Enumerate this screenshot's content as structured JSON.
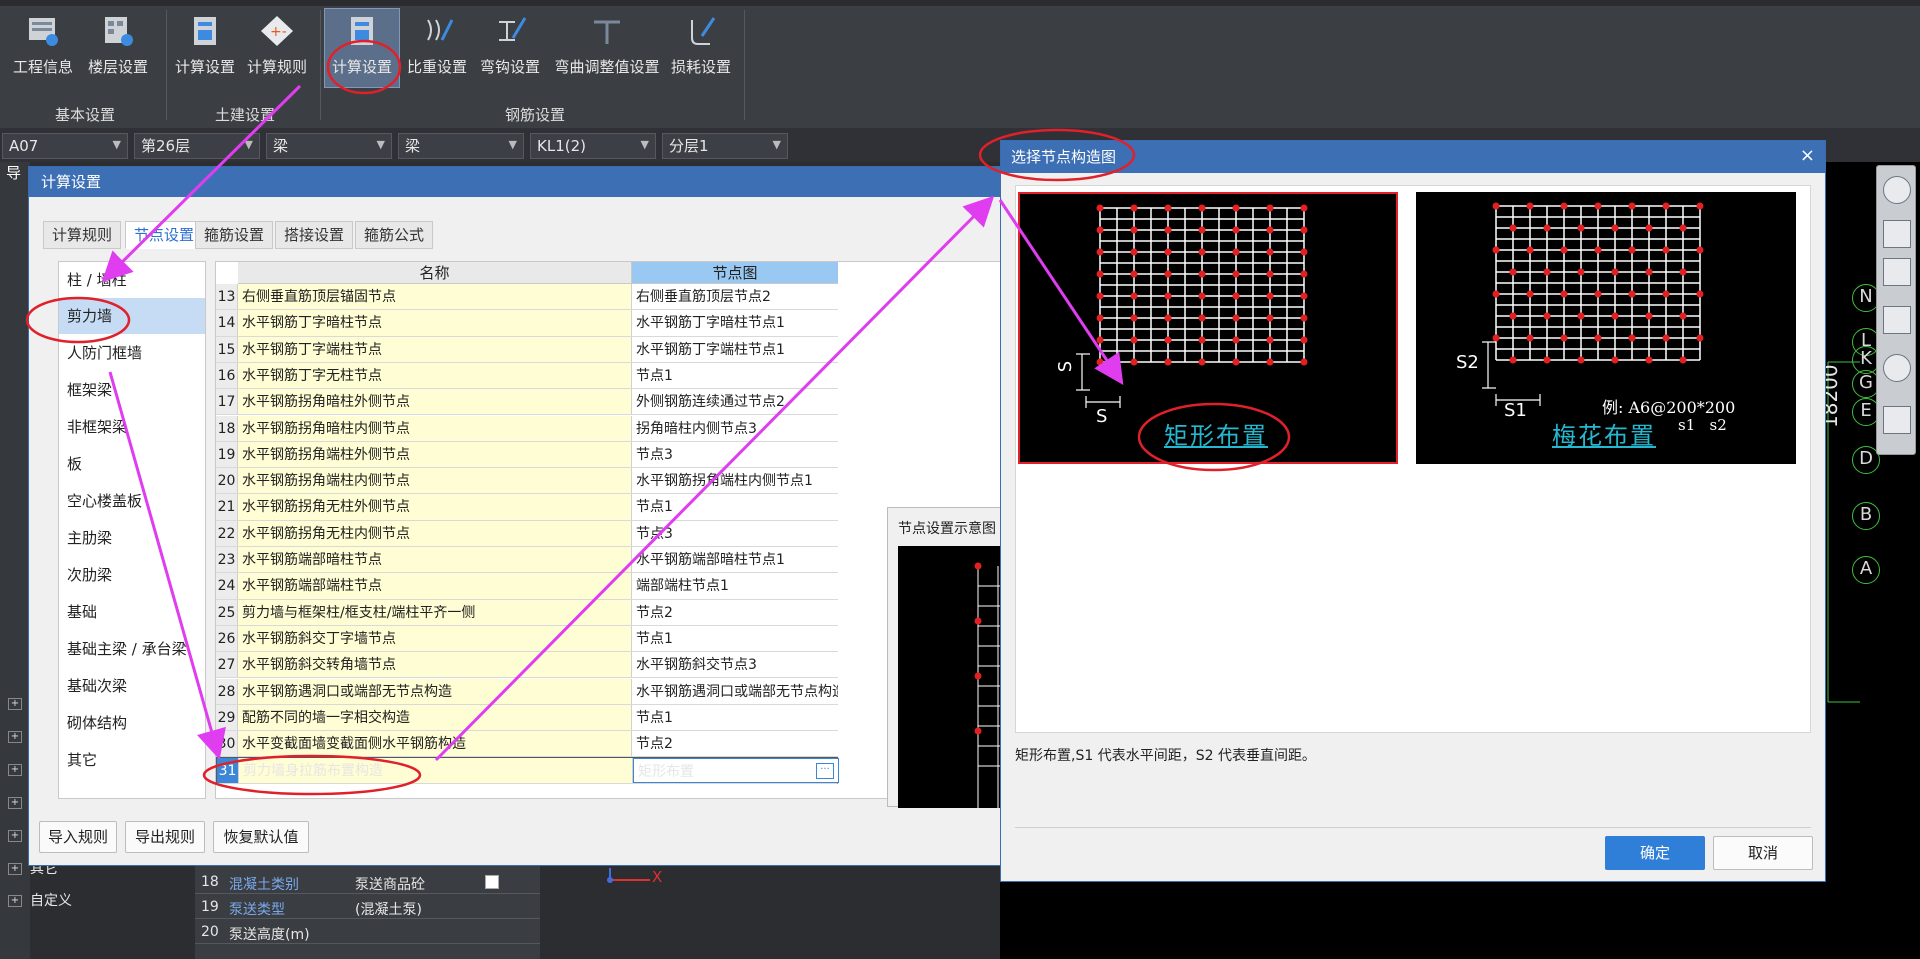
{
  "ribbon": {
    "buttons": [
      {
        "label": "工程信息",
        "icon": "project-info-icon"
      },
      {
        "label": "楼层设置",
        "icon": "floor-settings-icon"
      },
      {
        "label": "计算设置",
        "icon": "calc-settings-icon"
      },
      {
        "label": "计算规则",
        "icon": "calc-rules-icon"
      },
      {
        "label": "计算设置",
        "icon": "rebar-calc-settings-icon"
      },
      {
        "label": "比重设置",
        "icon": "density-settings-icon"
      },
      {
        "label": "弯钩设置",
        "icon": "hook-settings-icon"
      },
      {
        "label": "弯曲调整值设置",
        "icon": "bend-adjust-icon"
      },
      {
        "label": "损耗设置",
        "icon": "loss-settings-icon"
      }
    ],
    "groups": [
      "基本设置",
      "土建设置",
      "钢筋设置"
    ]
  },
  "selectors": [
    "A07",
    "第26层",
    "梁",
    "梁",
    "KL1(2)",
    "分层1"
  ],
  "calc_dialog": {
    "title": "计算设置",
    "left_stub": "导",
    "tabs": [
      "计算规则",
      "节点设置",
      "箍筋设置",
      "搭接设置",
      "箍筋公式"
    ],
    "categories": [
      "柱 / 墙柱",
      "剪力墙",
      "人防门框墙",
      "框架梁",
      "非框架梁",
      "板",
      "空心楼盖板",
      "主肋梁",
      "次肋梁",
      "基础",
      "基础主梁 / 承台梁",
      "基础次梁",
      "砌体结构",
      "其它"
    ],
    "columns": {
      "name": "名称",
      "node": "节点图"
    },
    "rows": [
      {
        "no": "13",
        "name": "右侧垂直筋顶层锚固节点",
        "value": "右侧垂直筋顶层节点2"
      },
      {
        "no": "14",
        "name": "水平钢筋丁字暗柱节点",
        "value": "水平钢筋丁字暗柱节点1"
      },
      {
        "no": "15",
        "name": "水平钢筋丁字端柱节点",
        "value": "水平钢筋丁字端柱节点1"
      },
      {
        "no": "16",
        "name": "水平钢筋丁字无柱节点",
        "value": "节点1"
      },
      {
        "no": "17",
        "name": "水平钢筋拐角暗柱外侧节点",
        "value": "外侧钢筋连续通过节点2"
      },
      {
        "no": "18",
        "name": "水平钢筋拐角暗柱内侧节点",
        "value": "拐角暗柱内侧节点3"
      },
      {
        "no": "19",
        "name": "水平钢筋拐角端柱外侧节点",
        "value": "节点3"
      },
      {
        "no": "20",
        "name": "水平钢筋拐角端柱内侧节点",
        "value": "水平钢筋拐角端柱内侧节点1"
      },
      {
        "no": "21",
        "name": "水平钢筋拐角无柱外侧节点",
        "value": "节点1"
      },
      {
        "no": "22",
        "name": "水平钢筋拐角无柱内侧节点",
        "value": "节点3"
      },
      {
        "no": "23",
        "name": "水平钢筋端部暗柱节点",
        "value": "水平钢筋端部暗柱节点1"
      },
      {
        "no": "24",
        "name": "水平钢筋端部端柱节点",
        "value": "端部端柱节点1"
      },
      {
        "no": "25",
        "name": "剪力墙与框架柱/框支柱/端柱平齐一侧",
        "value": "节点2"
      },
      {
        "no": "26",
        "name": "水平钢筋斜交丁字墙节点",
        "value": "节点1"
      },
      {
        "no": "27",
        "name": "水平钢筋斜交转角墙节点",
        "value": "水平钢筋斜交节点3"
      },
      {
        "no": "28",
        "name": "水平钢筋遇洞口或端部无节点构造",
        "value": "水平钢筋遇洞口或端部无节点构造2"
      },
      {
        "no": "29",
        "name": "配筋不同的墙一字相交构造",
        "value": "节点1"
      },
      {
        "no": "30",
        "name": "水平变截面墙变截面侧水平钢筋构造",
        "value": "节点2"
      },
      {
        "no": "31",
        "name": "剪力墙身拉筋布置构造",
        "value": "矩形布置"
      }
    ],
    "ellipsis": "···",
    "footer_buttons": [
      "导入规则",
      "导出规则",
      "恢复默认值"
    ],
    "preview_title": "节点设置示意图"
  },
  "node_dialog": {
    "title": "选择节点构造图",
    "close": "×",
    "options": [
      {
        "label": "矩形布置",
        "dims": [
          "S",
          "S"
        ],
        "selected": true
      },
      {
        "label": "梅花布置",
        "dims": [
          "S2",
          "S1"
        ],
        "example": "例: A6@200*200",
        "example_sub": "s1   s2",
        "selected": false
      }
    ],
    "description": "矩形布置,S1 代表水平间距，S2 代表垂直间距。",
    "ok": "确定",
    "cancel": "取消"
  },
  "cad": {
    "axis_labels": [
      "N",
      "L",
      "K",
      "G",
      "E",
      "D",
      "B",
      "A"
    ],
    "dimension": "18200",
    "coord_x": "X"
  },
  "left_nav": {
    "items": [
      "其它",
      "自定义"
    ]
  },
  "props": {
    "rows": [
      {
        "no": "18",
        "name": "混凝土类别",
        "value": "泵送商品砼"
      },
      {
        "no": "19",
        "name": "泵送类型",
        "value": "(混凝土泵)"
      },
      {
        "no": "20",
        "name": "泵送高度(m)",
        "value": ""
      }
    ]
  },
  "colors": {
    "accent": "#3d6fb5",
    "annotation": "#e03cf0",
    "highlight": "#e0202a",
    "ok": "#2f7ed8"
  }
}
